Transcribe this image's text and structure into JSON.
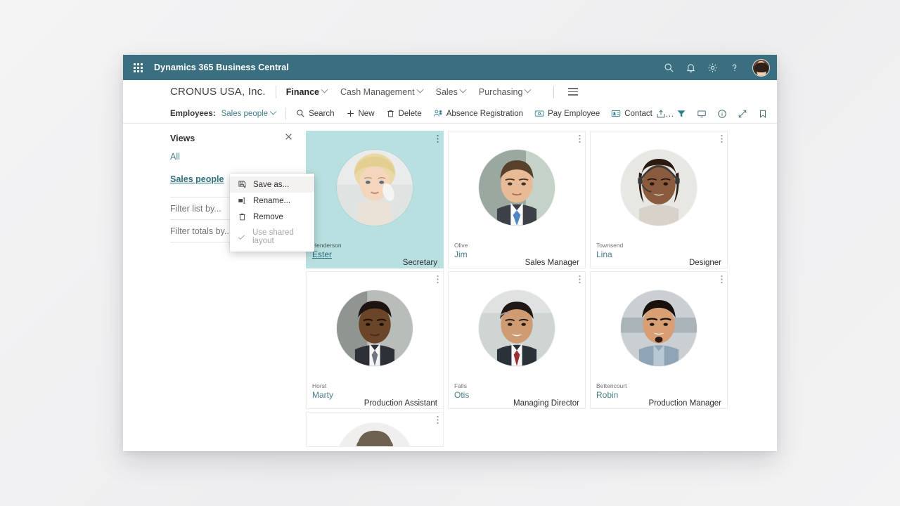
{
  "app": {
    "title": "Dynamics 365 Business Central",
    "waffle_icon": "app-launcher-icon",
    "header_icons": [
      "search-icon",
      "bell-icon",
      "gear-icon",
      "help-icon",
      "user-avatar"
    ],
    "accent_color": "#3a6f80"
  },
  "nav": {
    "company": "CRONUS USA, Inc.",
    "items": [
      {
        "label": "Finance",
        "active": true
      },
      {
        "label": "Cash Management",
        "active": false
      },
      {
        "label": "Sales",
        "active": false
      },
      {
        "label": "Purchasing",
        "active": false
      }
    ],
    "more_icon": "hamburger-icon"
  },
  "commandbar": {
    "entity_label": "Employees:",
    "view_selector": "Sales people",
    "actions": [
      {
        "label": "Search",
        "icon": "search-icon"
      },
      {
        "label": "New",
        "icon": "plus-icon"
      },
      {
        "label": "Delete",
        "icon": "trash-icon"
      },
      {
        "label": "Absence Registration",
        "icon": "person-clock-icon"
      },
      {
        "label": "Pay Employee",
        "icon": "money-icon"
      },
      {
        "label": "Contact",
        "icon": "contact-card-icon"
      }
    ],
    "overflow": "…",
    "right_icons": [
      "share-icon",
      "filter-icon",
      "monitor-icon",
      "info-icon",
      "expand-icon",
      "bookmark-icon"
    ]
  },
  "views_pane": {
    "title": "Views",
    "close_icon": "close-icon",
    "items": [
      {
        "label": "All",
        "selected": false
      },
      {
        "label": "Sales people",
        "selected": true
      }
    ],
    "filters": [
      {
        "label": "Filter list by..."
      },
      {
        "label": "Filter totals by..."
      }
    ]
  },
  "context_menu": {
    "items": [
      {
        "label": "Save as...",
        "icon": "save-as-icon",
        "disabled": false,
        "hover": true
      },
      {
        "label": "Rename...",
        "icon": "rename-icon",
        "disabled": false,
        "hover": false
      },
      {
        "label": "Remove",
        "icon": "trash-icon",
        "disabled": false,
        "hover": false
      },
      {
        "label": "Use shared layout",
        "icon": "check-icon",
        "disabled": true,
        "hover": false
      }
    ]
  },
  "employees": [
    {
      "last_name": "Henderson",
      "first_name": "Ester",
      "job_title": "Secretary",
      "selected": true,
      "photo": "woman-blonde-phone"
    },
    {
      "last_name": "Olive",
      "first_name": "Jim",
      "job_title": "Sales Manager",
      "selected": false,
      "photo": "man-suit-bluetie"
    },
    {
      "last_name": "Townsend",
      "first_name": "Lina",
      "job_title": "Designer",
      "selected": false,
      "photo": "woman-headset"
    },
    {
      "last_name": "Horst",
      "first_name": "Marty",
      "job_title": "Production Assistant",
      "selected": false,
      "photo": "man-dark-suit"
    },
    {
      "last_name": "Falls",
      "first_name": "Otis",
      "job_title": "Managing Director",
      "selected": false,
      "photo": "man-greyhair-tie"
    },
    {
      "last_name": "Bettencourt",
      "first_name": "Robin",
      "job_title": "Production Manager",
      "selected": false,
      "photo": "man-young-beard"
    }
  ],
  "partial_employee": {
    "photo": "man-hat-partial"
  }
}
